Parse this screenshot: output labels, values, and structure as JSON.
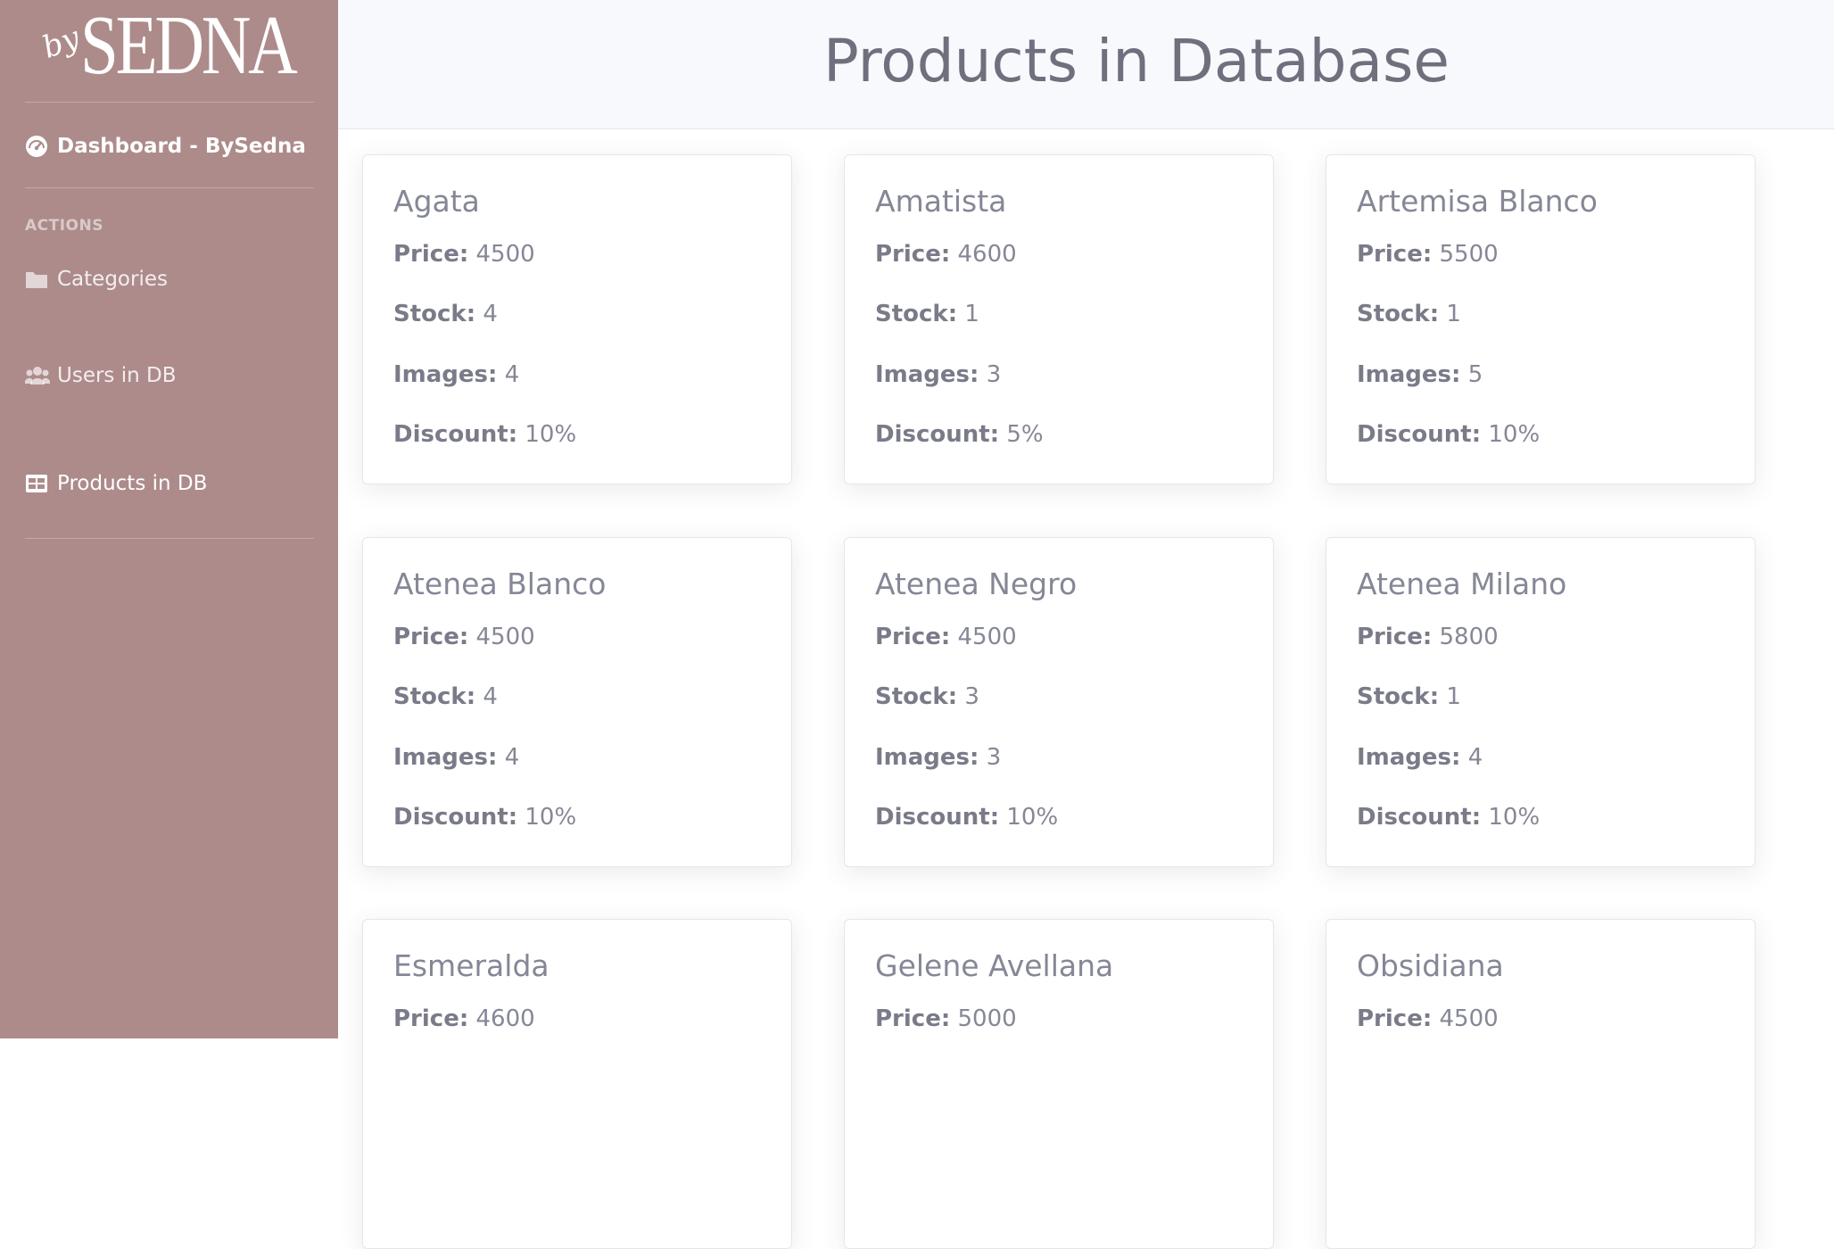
{
  "brand": {
    "prefix": "by",
    "name": "SEDNA"
  },
  "sidebar": {
    "dashboard_label": "Dashboard - BySedna",
    "section_heading": "ACTIONS",
    "items": [
      {
        "label": "Categories",
        "icon": "folder-icon"
      },
      {
        "label": "Users in DB",
        "icon": "users-icon"
      },
      {
        "label": "Products in DB",
        "icon": "table-icon"
      }
    ]
  },
  "header": {
    "title": "Products in Database"
  },
  "labels": {
    "price": "Price:",
    "stock": "Stock:",
    "images": "Images:",
    "discount": "Discount:"
  },
  "products": [
    {
      "name": "Agata",
      "price": "4500",
      "stock": "4",
      "images": "4",
      "discount": "10%"
    },
    {
      "name": "Amatista",
      "price": "4600",
      "stock": "1",
      "images": "3",
      "discount": "5%"
    },
    {
      "name": "Artemisa Blanco",
      "price": "5500",
      "stock": "1",
      "images": "5",
      "discount": "10%"
    },
    {
      "name": "Atenea Blanco",
      "price": "4500",
      "stock": "4",
      "images": "4",
      "discount": "10%"
    },
    {
      "name": "Atenea Negro",
      "price": "4500",
      "stock": "3",
      "images": "3",
      "discount": "10%"
    },
    {
      "name": "Atenea Milano",
      "price": "5800",
      "stock": "1",
      "images": "4",
      "discount": "10%"
    },
    {
      "name": "Esmeralda",
      "price": "4600"
    },
    {
      "name": "Gelene Avellana",
      "price": "5000"
    },
    {
      "name": "Obsidiana",
      "price": "4500"
    }
  ],
  "colors": {
    "sidebar": "#ad8b8b",
    "text": "#858796",
    "background": "#ffffff"
  }
}
